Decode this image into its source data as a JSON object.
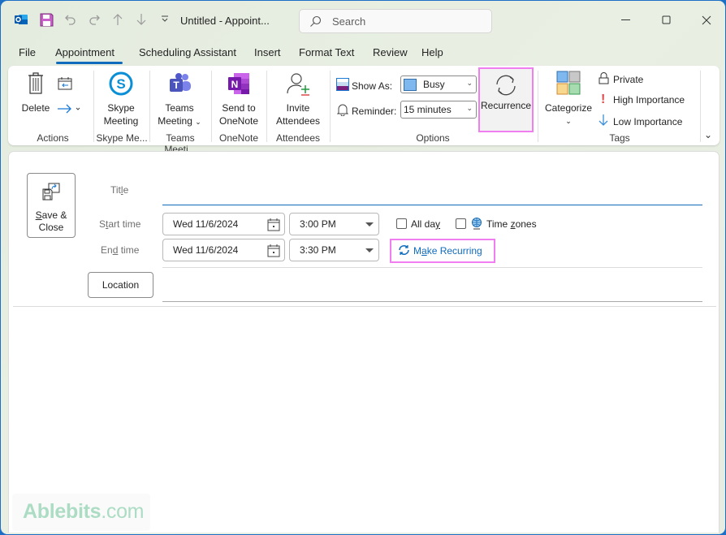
{
  "window": {
    "title": "Untitled  -  Appoint...",
    "search_placeholder": "Search",
    "controls": [
      "minimize",
      "maximize",
      "close"
    ]
  },
  "quick_access": [
    "outlook-app-icon",
    "save-icon",
    "undo-icon",
    "redo-icon",
    "previous-item-icon",
    "next-item-icon",
    "customize-qat-icon"
  ],
  "menu_tabs": [
    {
      "label": "File",
      "active": false
    },
    {
      "label": "Appointment",
      "active": true
    },
    {
      "label": "Scheduling Assistant",
      "active": false
    },
    {
      "label": "Insert",
      "active": false
    },
    {
      "label": "Format Text",
      "active": false
    },
    {
      "label": "Review",
      "active": false
    },
    {
      "label": "Help",
      "active": false
    }
  ],
  "ribbon": {
    "groups": {
      "actions": "Actions",
      "skype": "Skype Me...",
      "teams": "Teams Meeti...",
      "onenote": "OneNote",
      "attendees": "Attendees",
      "options": "Options",
      "tags": "Tags"
    },
    "delete_label": "Delete",
    "skype_label_1": "Skype",
    "skype_label_2": "Meeting",
    "teams_label_1": "Teams",
    "teams_label_2": "Meeting",
    "onenote_label_1": "Send to",
    "onenote_label_2": "OneNote",
    "invite_label_1": "Invite",
    "invite_label_2": "Attendees",
    "show_as_label": "Show As:",
    "show_as_value": "Busy",
    "show_as_color": "#7fb8ee",
    "reminder_label": "Reminder:",
    "reminder_value": "15 minutes",
    "recurrence_label": "Recurrence",
    "categorize_label": "Categorize",
    "private_label": "Private",
    "high_importance_label": "High Importance",
    "low_importance_label": "Low Importance"
  },
  "form": {
    "save_close_1": "ave &",
    "save_close_1_accel": "S",
    "save_close_2": "Close",
    "title_label_pre": "Tit",
    "title_label_accel": "l",
    "title_label_post": "e",
    "title_value": "",
    "start_label_pre": "S",
    "start_label_accel": "t",
    "start_label_post": "art time",
    "end_label_pre": "En",
    "end_label_accel": "d",
    "end_label_post": " time",
    "start_date": "Wed 11/6/2024",
    "start_time": "3:00 PM",
    "end_date": "Wed 11/6/2024",
    "end_time": "3:30 PM",
    "all_day_pre": "All da",
    "all_day_accel": "y",
    "all_day_checked": false,
    "time_zones_pre": "Time ",
    "time_zones_accel": "z",
    "time_zones_post": "ones",
    "time_zones_checked": false,
    "make_recurring_pre": "M",
    "make_recurring_accel": "a",
    "make_recurring_post": "ke Recurring",
    "location_label": "Location",
    "location_value": ""
  },
  "colors": {
    "accent": "#0f6cbd",
    "highlight": "#f07ef0",
    "high_importance": "#e04848",
    "low_importance": "#3a8fd8"
  },
  "watermark": {
    "brand": "Ablebits",
    "domain": ".com"
  }
}
